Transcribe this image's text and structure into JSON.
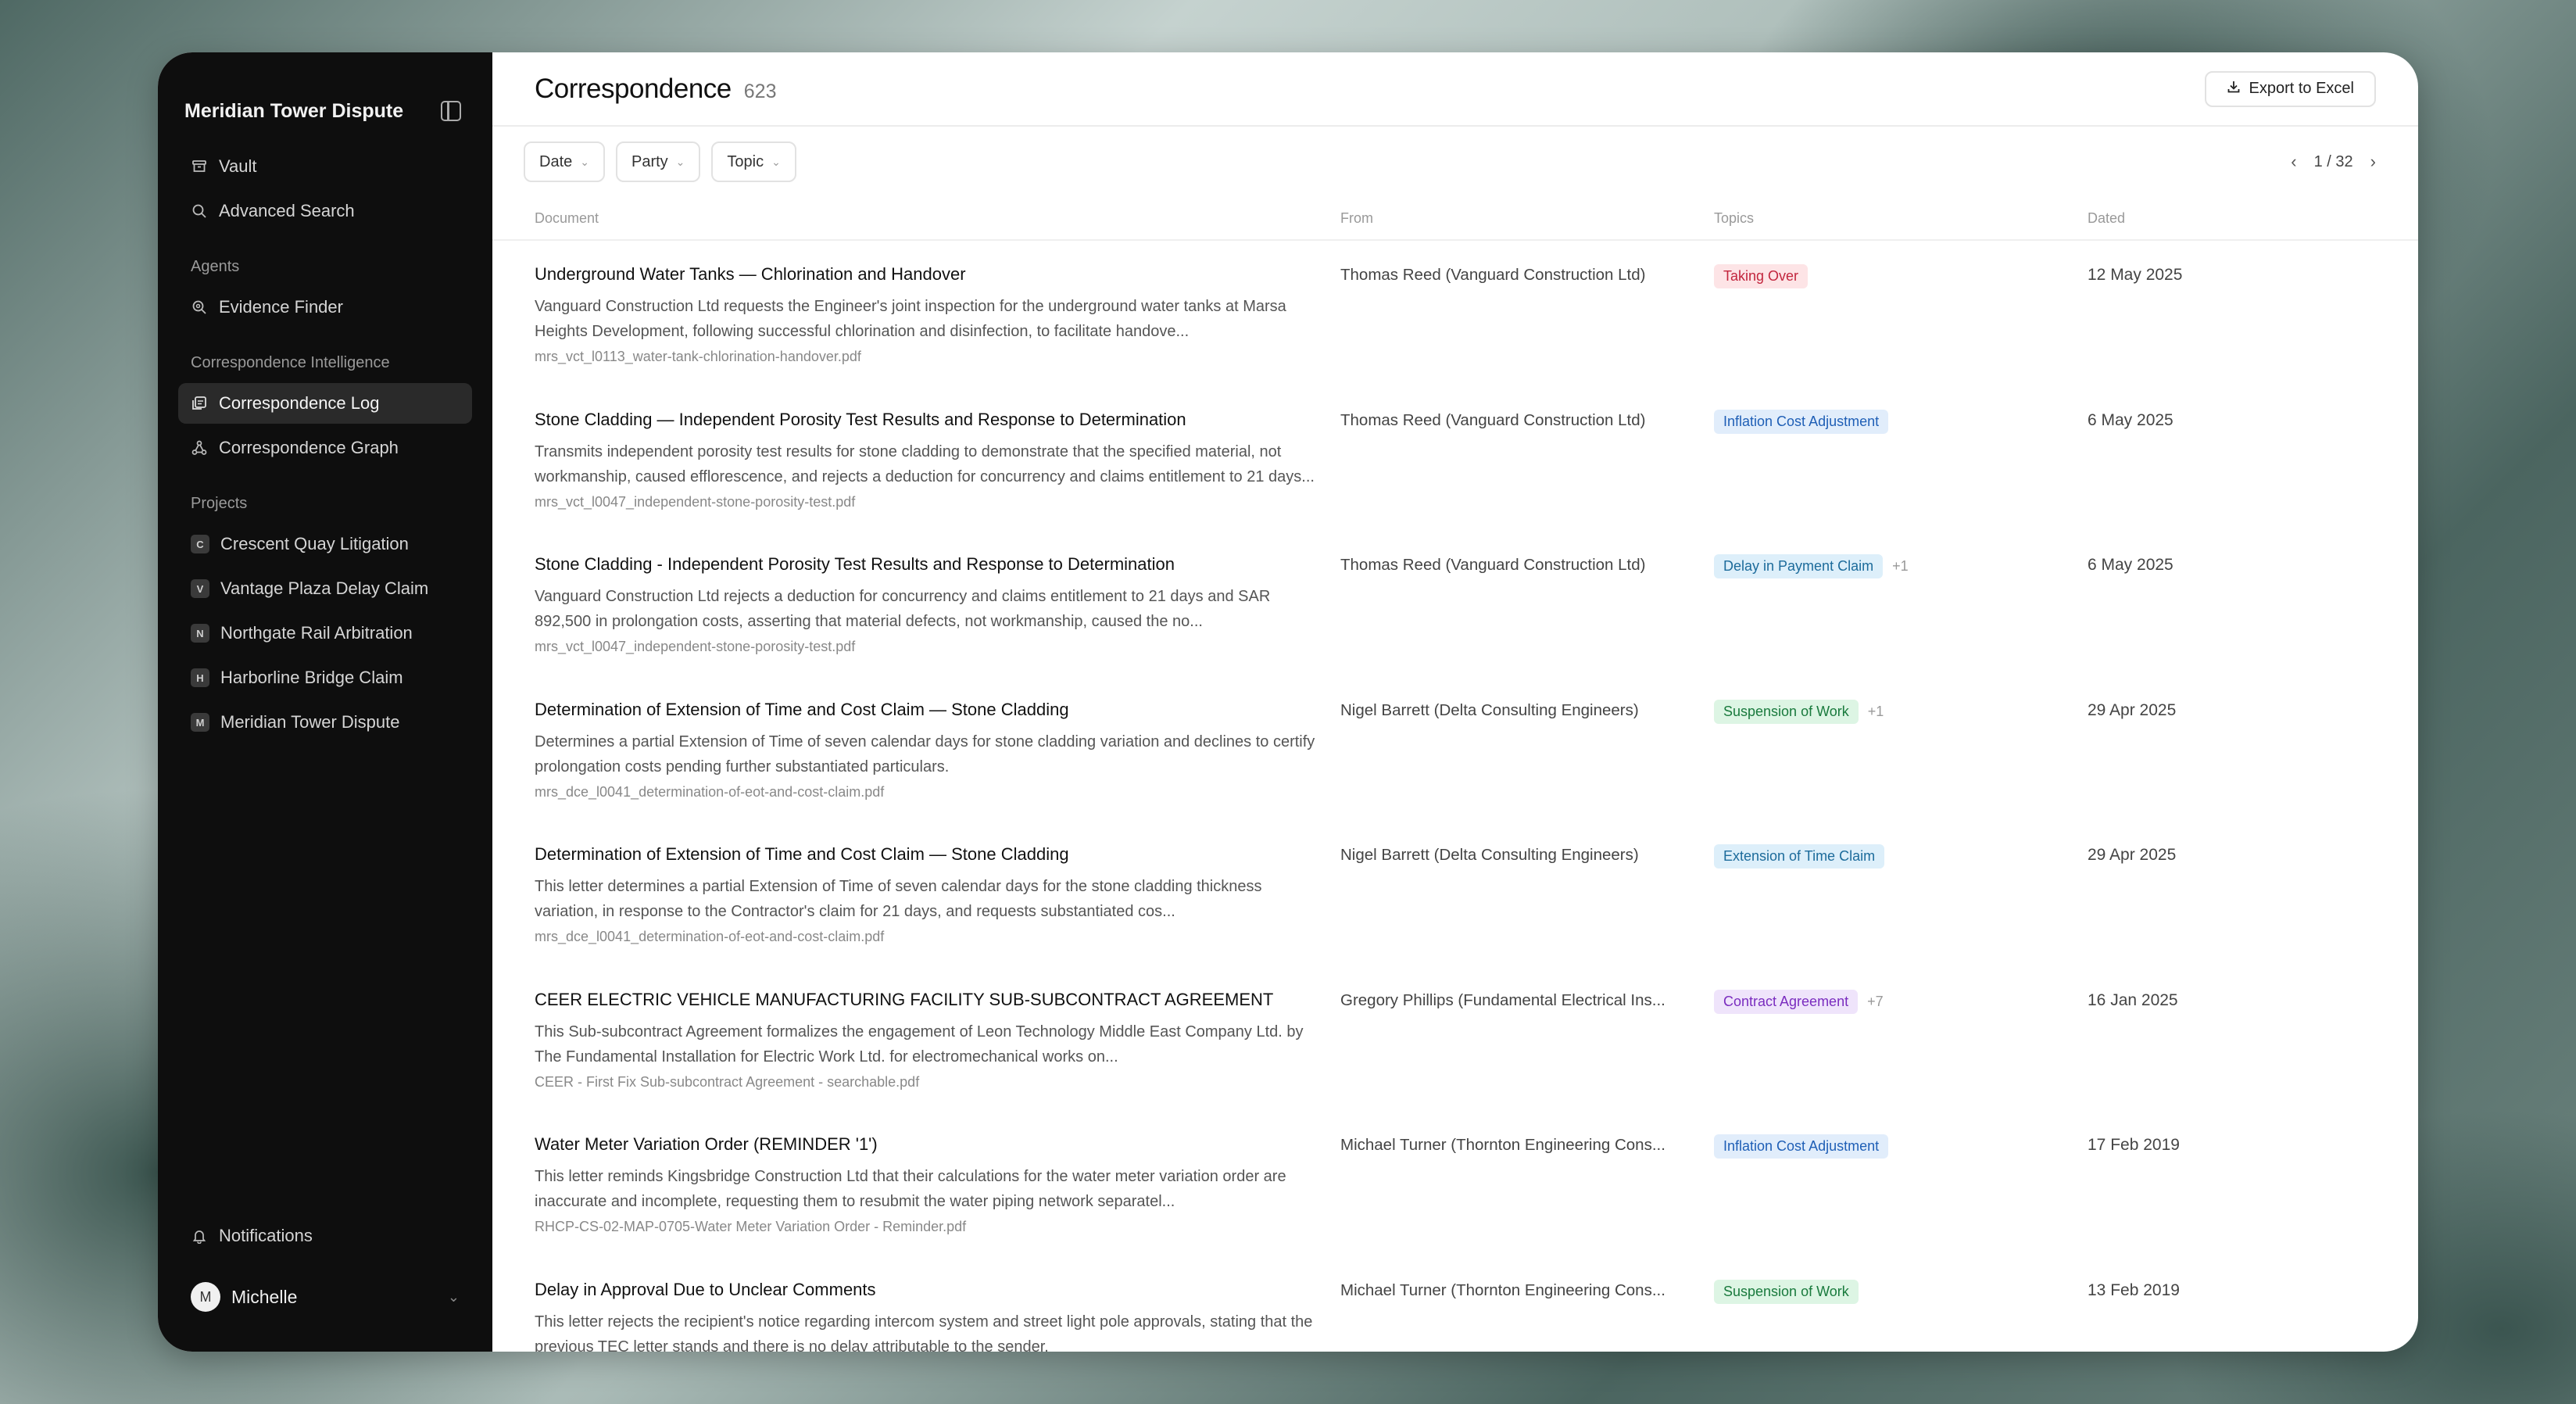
{
  "sidebar": {
    "title": "Meridian Tower Dispute",
    "nav": [
      {
        "label": "Vault",
        "icon": "archive-icon"
      },
      {
        "label": "Advanced Search",
        "icon": "search-icon"
      }
    ],
    "agents_heading": "Agents",
    "agents": [
      {
        "label": "Evidence Finder",
        "icon": "zoom-search-icon"
      }
    ],
    "ci_heading": "Correspondence Intelligence",
    "ci": [
      {
        "label": "Correspondence Log",
        "icon": "log-icon"
      },
      {
        "label": "Correspondence Graph",
        "icon": "graph-icon"
      }
    ],
    "projects_heading": "Projects",
    "projects": [
      {
        "badge": "C",
        "label": "Crescent Quay Litigation"
      },
      {
        "badge": "V",
        "label": "Vantage Plaza Delay Claim"
      },
      {
        "badge": "N",
        "label": "Northgate Rail Arbitration"
      },
      {
        "badge": "H",
        "label": "Harborline Bridge Claim"
      },
      {
        "badge": "M",
        "label": "Meridian Tower Dispute"
      }
    ],
    "notifications": "Notifications",
    "user": {
      "initial": "M",
      "name": "Michelle"
    }
  },
  "header": {
    "title": "Correspondence",
    "count": "623",
    "export_label": "Export to Excel"
  },
  "filters": [
    "Date",
    "Party",
    "Topic"
  ],
  "pager": {
    "text": "1 / 32"
  },
  "columns": {
    "document": "Document",
    "from": "From",
    "topics": "Topics",
    "dated": "Dated"
  },
  "rows": [
    {
      "title": "Underground Water Tanks — Chlorination and Handover",
      "summary": "Vanguard Construction Ltd requests the Engineer's joint inspection for the underground water tanks at Marsa Heights Development, following successful chlorination and disinfection, to facilitate handove...",
      "file": "mrs_vct_l0113_water-tank-chlorination-handover.pdf",
      "from": "Thomas Reed (Vanguard Construction Ltd)",
      "tag": "Taking Over",
      "tag_color": "red",
      "more": "",
      "date": "12 May 2025"
    },
    {
      "title": "Stone Cladding — Independent Porosity Test Results and Response to Determination",
      "summary": "Transmits independent porosity test results for stone cladding to demonstrate that the specified material, not workmanship, caused efflorescence, and rejects a deduction for concurrency and claims entitlement to 21 days...",
      "file": "mrs_vct_l0047_independent-stone-porosity-test.pdf",
      "from": "Thomas Reed (Vanguard Construction Ltd)",
      "tag": "Inflation Cost Adjustment",
      "tag_color": "blue",
      "more": "",
      "date": "6 May 2025"
    },
    {
      "title": "Stone Cladding - Independent Porosity Test Results and Response to Determination",
      "summary": "Vanguard Construction Ltd rejects a deduction for concurrency and claims entitlement to 21 days and SAR 892,500 in prolongation costs, asserting that material defects, not workmanship, caused the no...",
      "file": "mrs_vct_l0047_independent-stone-porosity-test.pdf",
      "from": "Thomas Reed (Vanguard Construction Ltd)",
      "tag": "Delay in Payment Claim",
      "tag_color": "teal",
      "more": "+1",
      "date": "6 May 2025"
    },
    {
      "title": "Determination of Extension of Time and Cost Claim — Stone Cladding",
      "summary": "Determines a partial Extension of Time of seven calendar days for stone cladding variation and declines to certify prolongation costs pending further substantiated particulars.",
      "file": "mrs_dce_l0041_determination-of-eot-and-cost-claim.pdf",
      "from": "Nigel Barrett (Delta Consulting Engineers)",
      "tag": "Suspension of Work",
      "tag_color": "green",
      "more": "+1",
      "date": "29 Apr 2025"
    },
    {
      "title": "Determination of Extension of Time and Cost Claim — Stone Cladding",
      "summary": "This letter determines a partial Extension of Time of seven calendar days for the stone cladding thickness variation, in response to the Contractor's claim for 21 days, and requests substantiated cos...",
      "file": "mrs_dce_l0041_determination-of-eot-and-cost-claim.pdf",
      "from": "Nigel Barrett (Delta Consulting Engineers)",
      "tag": "Extension of Time Claim",
      "tag_color": "teal",
      "more": "",
      "date": "29 Apr 2025"
    },
    {
      "title": "CEER ELECTRIC VEHICLE MANUFACTURING FACILITY SUB-SUBCONTRACT AGREEMENT",
      "summary": "This Sub-subcontract Agreement formalizes the engagement of Leon Technology Middle East Company Ltd. by The Fundamental Installation for Electric Work Ltd. for electromechanical works on...",
      "file": "CEER - First Fix Sub-subcontract Agreement - searchable.pdf",
      "from": "Gregory Phillips (Fundamental Electrical Ins...",
      "tag": "Contract Agreement",
      "tag_color": "purple",
      "more": "+7",
      "date": "16 Jan 2025"
    },
    {
      "title": "Water Meter Variation Order (REMINDER '1')",
      "summary": "This letter reminds Kingsbridge Construction Ltd that their calculations for the water meter variation order are inaccurate and incomplete, requesting them to resubmit the water piping network separatel...",
      "file": "RHCP-CS-02-MAP-0705-Water Meter Variation Order - Reminder.pdf",
      "from": "Michael Turner (Thornton Engineering Cons...",
      "tag": "Inflation Cost Adjustment",
      "tag_color": "blue",
      "more": "",
      "date": "17 Feb 2019"
    },
    {
      "title": "Delay in Approval Due to Unclear Comments",
      "summary": "This letter rejects the recipient's notice regarding intercom system and street light pole approvals, stating that the previous TEC letter stands and there is no delay attributable to the sender.",
      "file": "",
      "from": "Michael Turner (Thornton Engineering Cons...",
      "tag": "Suspension of Work",
      "tag_color": "green",
      "more": "",
      "date": "13 Feb 2019"
    }
  ]
}
